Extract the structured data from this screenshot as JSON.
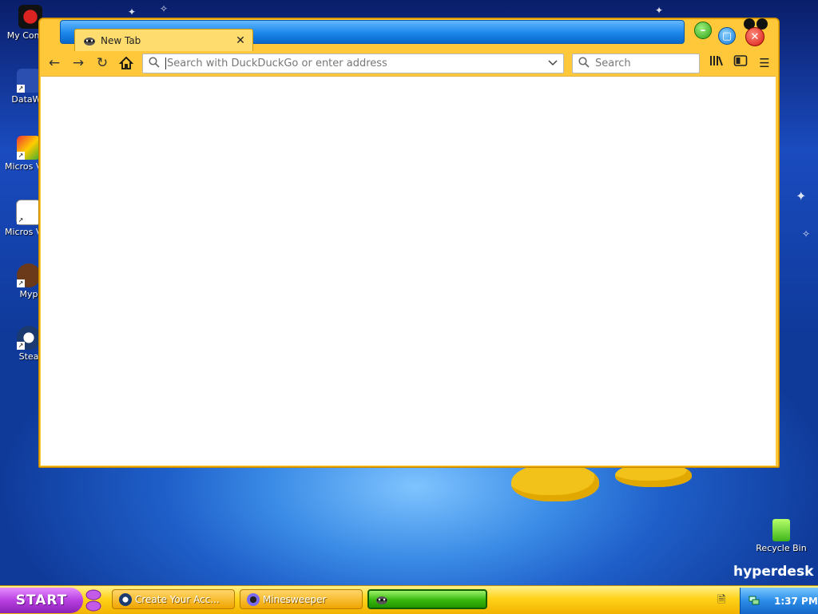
{
  "desktop": {
    "icons": [
      {
        "label": "My Compu",
        "icon": "computer-icon"
      },
      {
        "label": "DataWa",
        "icon": "datawarehouse-icon"
      },
      {
        "label": "Micros Visual",
        "icon": "visual-studio-icon"
      },
      {
        "label": "Micros Visual E",
        "icon": "visual-basic-icon"
      },
      {
        "label": "Myp",
        "icon": "mypaint-icon"
      },
      {
        "label": "Stea",
        "icon": "steam-icon"
      }
    ],
    "recycle_bin": "Recycle Bin",
    "brand": "hyperdesk"
  },
  "browser": {
    "tab_title": "New Tab",
    "url_placeholder": "Search with DuckDuckGo or enter address",
    "search_placeholder": "Search"
  },
  "taskbar": {
    "start_label": "START",
    "buttons": [
      {
        "label": "Create Your Acc...",
        "icon": "steam-icon"
      },
      {
        "label": "Minesweeper",
        "icon": "minesweeper-icon"
      },
      {
        "label": "",
        "icon": "browser-icon",
        "active": true
      }
    ],
    "clock": "1:37 PM"
  },
  "colors": {
    "window_frame": "#ffc83a",
    "titlebar_blue": "#1a86ea",
    "taskbar_yellow": "#ffd21a",
    "start_purple": "#b83fe0",
    "active_task_green": "#38b80e"
  }
}
